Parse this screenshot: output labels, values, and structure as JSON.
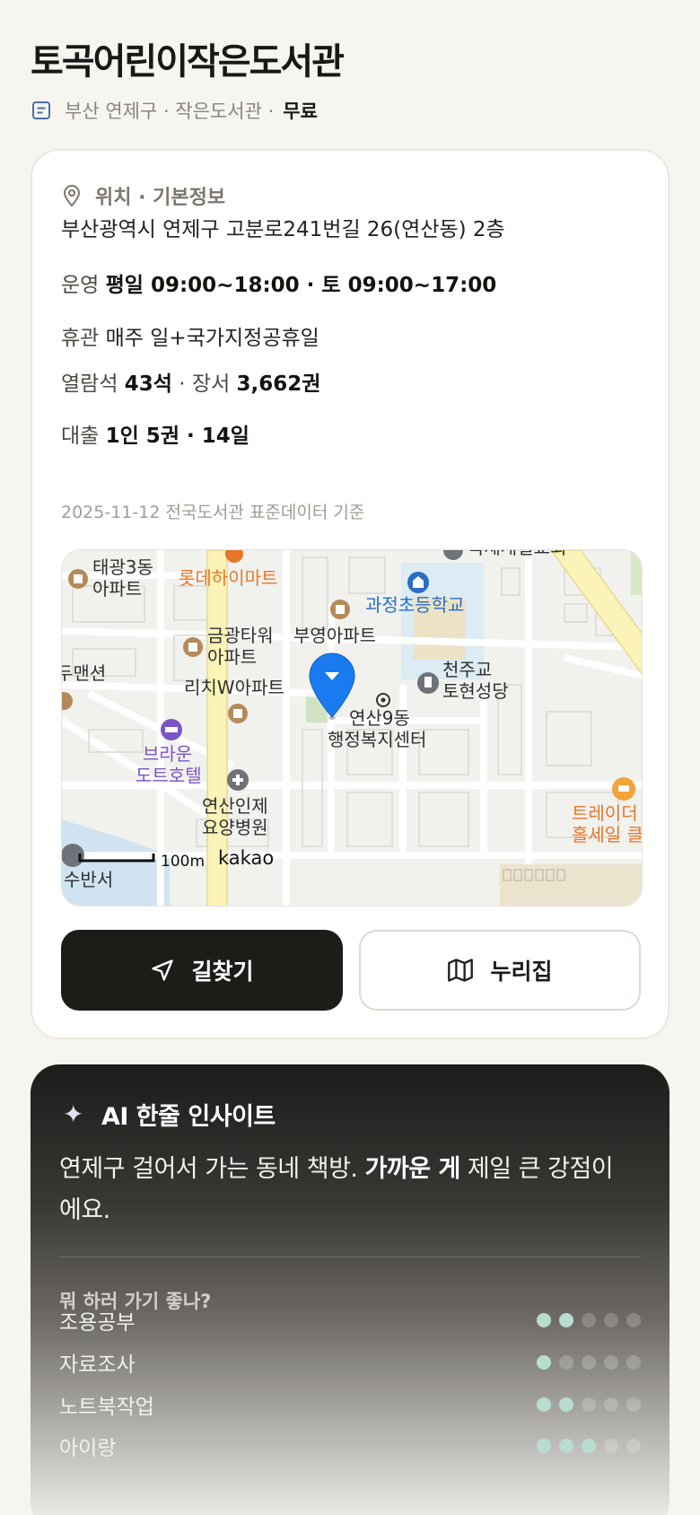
{
  "header": {
    "title": "토곡어린이작은도서관",
    "subtitle_prefix": "부산 연제구 · 작은도서관 ·",
    "fee": "무료"
  },
  "info": {
    "section_title": "위치 · 기본정보",
    "address": "부산광역시 연제구 고분로241번길 26(연산동) 2층",
    "hours_label": "운영",
    "hours_value": "평일 09:00~18:00 · 토 09:00~17:00",
    "closed_label": "휴관",
    "closed_value": "매주 일+국가지정공휴일",
    "seats_label": "열람석",
    "seats_value": "43석",
    "sep": "·",
    "books_label": "장서",
    "books_value": "3,662권",
    "loan_label": "대출",
    "loan_value": "1인 5권 · 14일",
    "source": "2025-11-12 전국도서관 표준데이터 기준"
  },
  "map": {
    "labels": {
      "taegwang": [
        "태광3동",
        "아파트"
      ],
      "lotte": "롯데하이마트",
      "school": "과정초등학교",
      "geumgwang": [
        "금광타워",
        "아파트"
      ],
      "buyoung": "부영아파트",
      "mansion": "두맨션",
      "church": [
        "천주교",
        "토현성당"
      ],
      "rich": "리치W아파트",
      "center": [
        "연산9동",
        "행정복지센터"
      ],
      "hotel": [
        "브라운",
        "도트호텔"
      ],
      "hospital": [
        "연산인제",
        "요양병원"
      ],
      "traders": [
        "트레이더",
        "홀세일 클"
      ],
      "station": "수반서",
      "top_cut": "국제개일교회"
    },
    "scale": "100m",
    "brand": "kakao",
    "colors": {
      "pin": "#1a7bf0",
      "accent_orange": "#e8762b",
      "school_blue": "#2b6cc4",
      "hotel_purple": "#7a55c7"
    }
  },
  "actions": {
    "directions": "길찾기",
    "nurijip": "누리집"
  },
  "ai": {
    "title": "AI 한줄 인사이트",
    "body_pre": "연제구 걸어서 가는 동네 책방. ",
    "body_bold": "가까운 게",
    "body_post": " 제일 큰 강점이에요.",
    "question": "뭐 하러 가기 좋나?",
    "uses": [
      {
        "name": "조용공부",
        "score": 2,
        "max": 5
      },
      {
        "name": "자료조사",
        "score": 1,
        "max": 5
      },
      {
        "name": "노트북작업",
        "score": 2,
        "max": 5
      },
      {
        "name": "아이랑",
        "score": 3,
        "max": 5
      }
    ]
  }
}
